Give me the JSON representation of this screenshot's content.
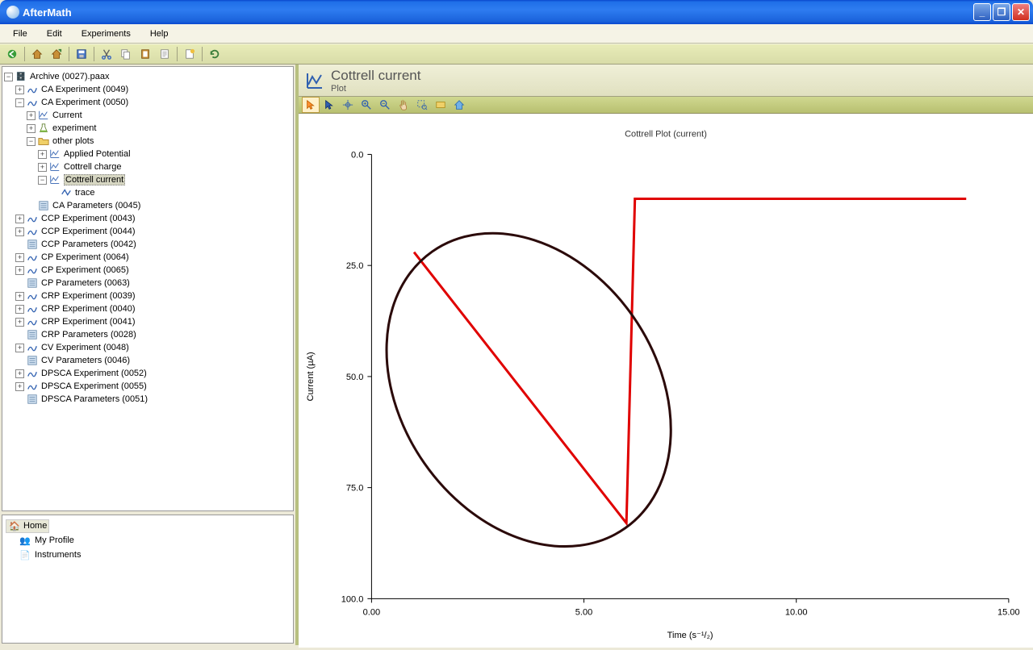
{
  "window": {
    "title": "AfterMath"
  },
  "menu": {
    "file": "File",
    "edit": "Edit",
    "experiments": "Experiments",
    "help": "Help"
  },
  "tree": {
    "root": "Archive (0027).paax",
    "items": [
      "CA Experiment (0049)",
      "CA Experiment (0050)",
      "Current",
      "experiment",
      "other plots",
      "Applied Potential",
      "Cottrell charge",
      "Cottrell current",
      "trace",
      "CA Parameters (0045)",
      "CCP Experiment (0043)",
      "CCP Experiment (0044)",
      "CCP Parameters (0042)",
      "CP Experiment (0064)",
      "CP Experiment (0065)",
      "CP Parameters (0063)",
      "CRP Experiment (0039)",
      "CRP Experiment (0040)",
      "CRP Experiment (0041)",
      "CRP Parameters (0028)",
      "CV Experiment (0048)",
      "CV Parameters (0046)",
      "DPSCA Experiment (0052)",
      "DPSCA Experiment (0055)",
      "DPSCA Parameters (0051)"
    ]
  },
  "home": {
    "header": "Home",
    "profile": "My Profile",
    "instruments": "Instruments"
  },
  "plot": {
    "header_title": "Cottrell current",
    "header_sub": "Plot"
  },
  "chart_data": {
    "type": "line",
    "title": "Cottrell Plot (current)",
    "xlabel": "Time (s⁻¹/₂)",
    "ylabel": "Current (µA)",
    "xlim": [
      0,
      15
    ],
    "ylim": [
      100,
      0
    ],
    "xticks": [
      0.0,
      5.0,
      10.0,
      15.0
    ],
    "yticks": [
      0.0,
      25.0,
      50.0,
      75.0,
      100.0
    ],
    "series": [
      {
        "name": "trace",
        "color": "#e00000",
        "x": [
          1.0,
          6.0,
          6.2,
          14.0
        ],
        "y": [
          22,
          83,
          10,
          10
        ]
      }
    ],
    "annotation": {
      "type": "ellipse",
      "cx": 3.7,
      "cy": 53,
      "rx": 3.0,
      "ry": 38,
      "rotation_deg": -35,
      "stroke": "#2b0a0a"
    }
  }
}
